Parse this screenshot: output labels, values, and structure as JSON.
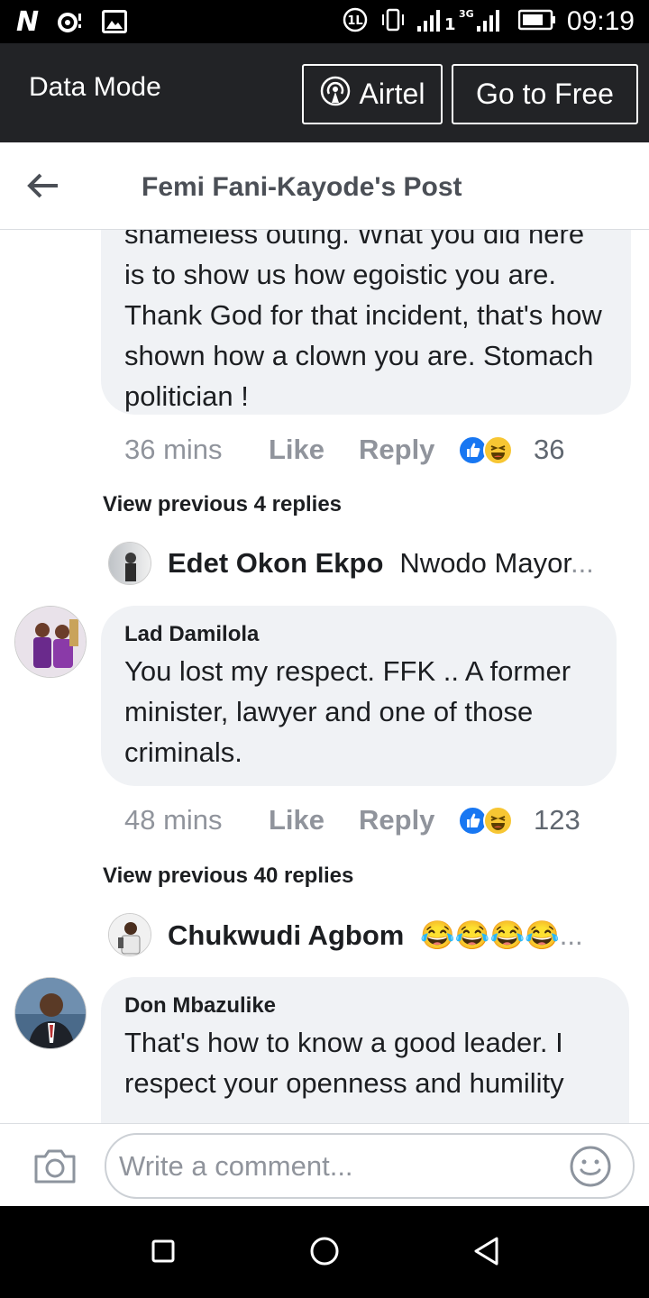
{
  "status_bar": {
    "time": "09:19",
    "network": "3G",
    "icons": [
      "netflix-n-icon",
      "music-icon",
      "image-icon",
      "sim-icon",
      "vibrate-icon",
      "signal-icon",
      "battery-icon"
    ]
  },
  "data_bar": {
    "label": "Data Mode",
    "airtel_label": "Airtel",
    "free_label": "Go to Free"
  },
  "header": {
    "title": "Femi Fani-Kayode's Post"
  },
  "comments": [
    {
      "text": "shameless outing. What you did here is to show us how egoistic you are. Thank God for that incident, that's how shown how a clown you are. Stomach politician !",
      "time": "36 mins",
      "like_label": "Like",
      "reply_label": "Reply",
      "reactions": "36",
      "view_previous": "View previous 4 replies",
      "latest_reply": {
        "name": "Edet Okon Ekpo",
        "snippet": "Nwodo Mayor"
      }
    },
    {
      "author": "Lad Damilola",
      "text": "You lost my respect. FFK .. A former minister, lawyer and one of those criminals.",
      "time": "48 mins",
      "like_label": "Like",
      "reply_label": "Reply",
      "reactions": "123",
      "view_previous": "View previous 40 replies",
      "latest_reply": {
        "name": "Chukwudi Agbom",
        "snippet": "😂😂😂😂"
      }
    },
    {
      "author": "Don Mbazulike",
      "text": "That's how to know a good leader. I respect your openness and humility"
    }
  ],
  "composer": {
    "placeholder": "Write a comment..."
  },
  "colors": {
    "top_bar": "#222326",
    "bubble": "#f0f2f5",
    "like_blue": "#1877f2",
    "meta_gray": "#90949c"
  }
}
